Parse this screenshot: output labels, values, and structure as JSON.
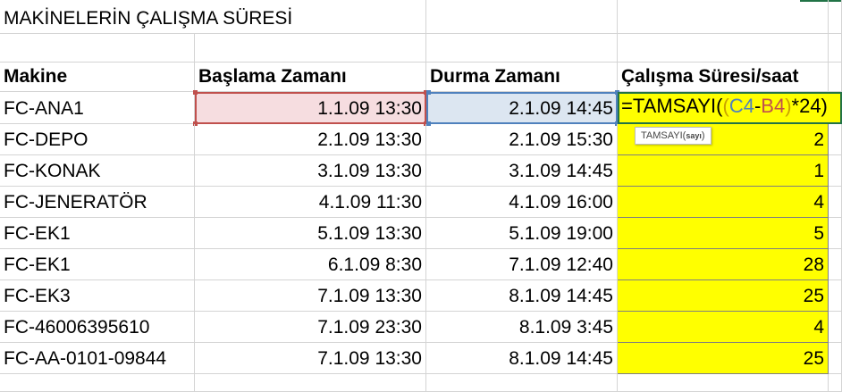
{
  "sheet": {
    "title": "MAKİNELERİN ÇALIŞMA SÜRESİ",
    "headers": [
      "Makine",
      "Başlama Zamanı",
      "Durma Zamanı",
      "Çalışma Süresi/saat"
    ],
    "rows": [
      {
        "machine": "FC-ANA1",
        "start": "1.1.09 13:30",
        "stop": "2.1.09 14:45",
        "hours": ""
      },
      {
        "machine": "FC-DEPO",
        "start": "2.1.09 13:30",
        "stop": "2.1.09 15:30",
        "hours": "2"
      },
      {
        "machine": "FC-KONAK",
        "start": "3.1.09 13:30",
        "stop": "3.1.09 14:45",
        "hours": "1"
      },
      {
        "machine": "FC-JENERATÖR",
        "start": "4.1.09 11:30",
        "stop": "4.1.09 16:00",
        "hours": "4"
      },
      {
        "machine": "FC-EK1",
        "start": "5.1.09 13:30",
        "stop": "5.1.09 19:00",
        "hours": "5"
      },
      {
        "machine": "FC-EK1",
        "start": "6.1.09 8:30",
        "stop": "7.1.09 12:40",
        "hours": "28"
      },
      {
        "machine": "FC-EK3",
        "start": "7.1.09 13:30",
        "stop": "8.1.09 14:45",
        "hours": "25"
      },
      {
        "machine": "FC-46006395610",
        "start": "7.1.09 23:30",
        "stop": "8.1.09 3:45",
        "hours": "4"
      },
      {
        "machine": "FC-AA-0101-09844",
        "start": "7.1.09 13:30",
        "stop": "8.1.09 14:45",
        "hours": "25"
      }
    ]
  },
  "editing": {
    "formula_parts": {
      "eq_func": "=TAMSAYI(",
      "open_paren": "(",
      "ref_c4": "C4",
      "minus": "-",
      "ref_b4": "B4",
      "close_paren": ")",
      "tail": "*24)"
    },
    "tooltip_func": "TAMSAYI(",
    "tooltip_arg": "sayı",
    "tooltip_close": ")"
  },
  "colors": {
    "highlight": "#ffff00",
    "ref_b4": "#c0504d",
    "ref_c4": "#4f81bd",
    "active_border": "#217346"
  }
}
